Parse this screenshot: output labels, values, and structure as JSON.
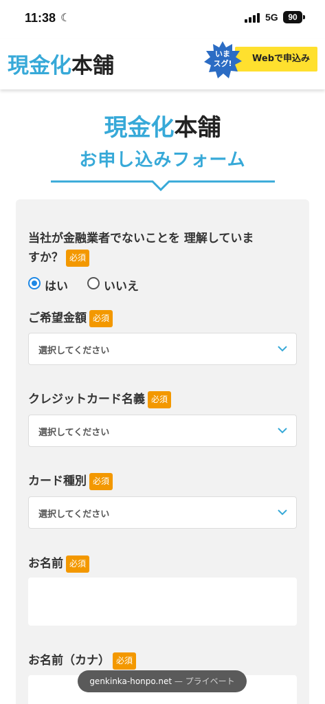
{
  "status_bar": {
    "time": "11:38",
    "moon_icon": "☾",
    "network": "5G",
    "battery": "90"
  },
  "header": {
    "logo_blue": "現金化",
    "logo_dark": "本舗",
    "cta_burst": "いま\nスグ!",
    "cta_label": "Webで申込み"
  },
  "hero": {
    "title_blue": "現金化",
    "title_dark": "本舗",
    "subtitle": "お申し込みフォーム"
  },
  "form": {
    "required_label": "必須",
    "q1": {
      "label_line1": "当社が金融業者でないことを 理解していま",
      "label_line2": "すか？",
      "options": [
        "はい",
        "いいえ"
      ],
      "selected": "はい"
    },
    "amount": {
      "label": "ご希望金額",
      "value": "選択してください"
    },
    "card_name": {
      "label": "クレジットカード名義",
      "value": "選択してください"
    },
    "card_type": {
      "label": "カード種別",
      "value": "選択してください"
    },
    "name": {
      "label": "お名前",
      "value": ""
    },
    "name_kana": {
      "label": "お名前（カナ）",
      "value": ""
    }
  },
  "browser": {
    "url": "genkinka-honpo.net",
    "mode": " — プライベート"
  },
  "colors": {
    "brand_blue": "#37a9d8",
    "cta_yellow": "#ffe02e",
    "badge_orange": "#f39800",
    "radio_blue": "#1e88e5"
  }
}
